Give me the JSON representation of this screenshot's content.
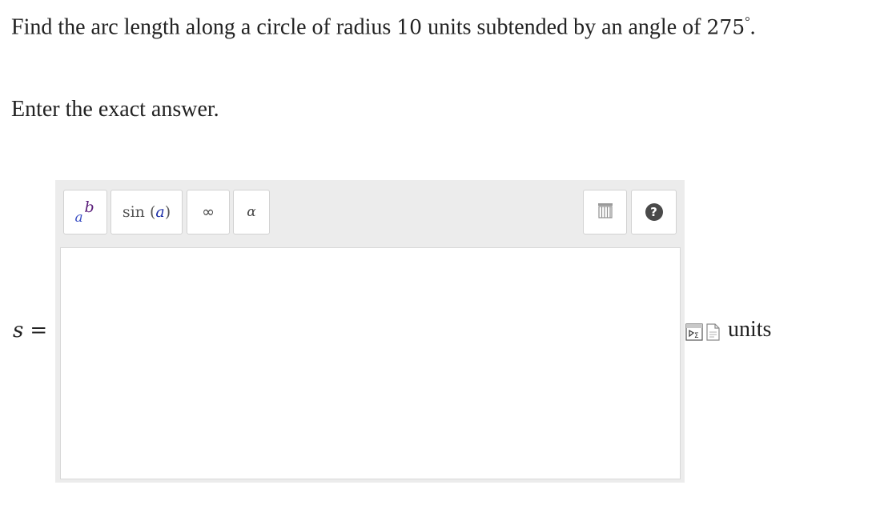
{
  "question": {
    "prefix": "Find the arc length along a circle of radius",
    "radius": "10",
    "middle": "units subtended by an angle of",
    "angle": "275",
    "degree_symbol": "°",
    "suffix": "."
  },
  "instruction": "Enter the exact answer.",
  "answer": {
    "variable": "s",
    "equals": "=",
    "value": "",
    "units_label": "units"
  },
  "toolbar": {
    "power_base": "a",
    "power_exponent": "b",
    "sin_func": "sin",
    "sin_open": "(",
    "sin_arg": "a",
    "sin_close": ")",
    "infinity": "∞",
    "alpha": "α",
    "help": "?"
  },
  "icons": {
    "power": "superscript-icon",
    "sin": "trig-function-icon",
    "infinity": "infinity-icon",
    "alpha": "greek-alpha-icon",
    "keyboard": "keyboard-icon",
    "help": "help-icon",
    "equation_editor": "equation-editor-icon",
    "document": "document-icon"
  },
  "colors": {
    "toolbar_bg": "#ececec",
    "button_bg": "#ffffff",
    "button_border": "#d2d2d2",
    "power_base": "#3b4fc4",
    "power_exponent": "#5a1e7a",
    "help_bg": "#4a4a4a"
  }
}
